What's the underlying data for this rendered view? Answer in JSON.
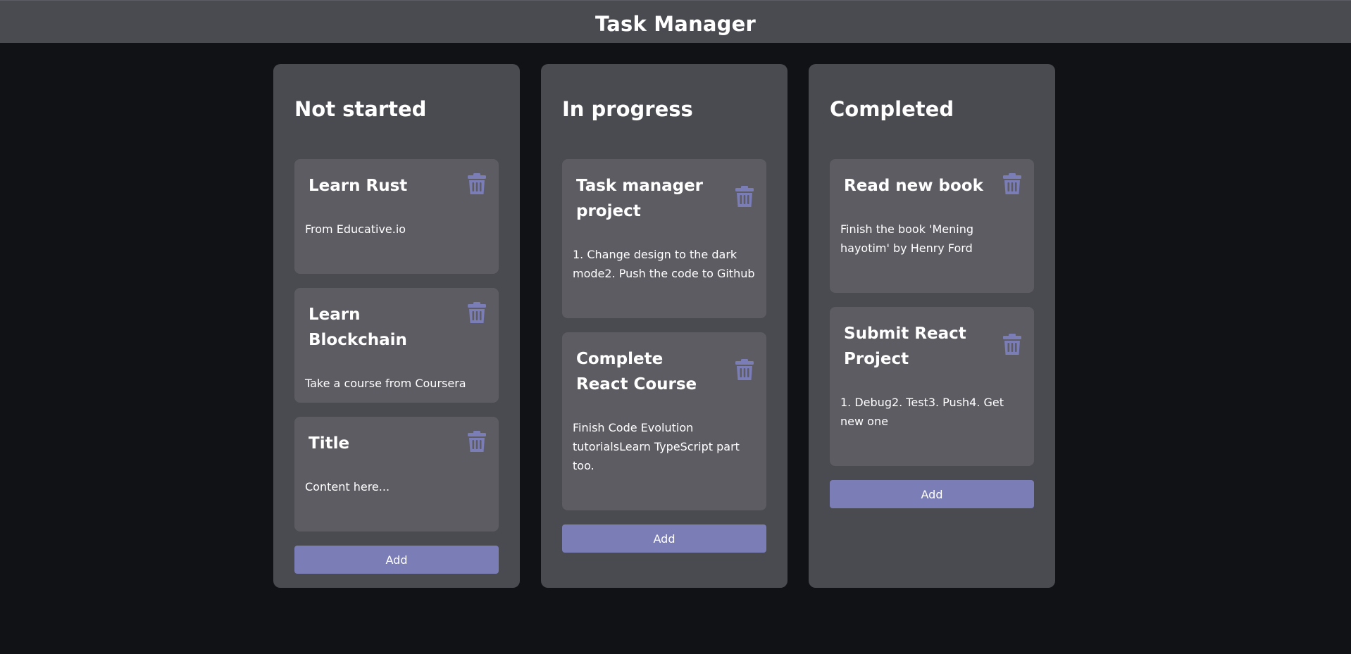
{
  "app": {
    "title": "Task Manager"
  },
  "colors": {
    "accent": "#7a7db6",
    "background": "#111215",
    "panel": "#4a4a51",
    "card": "#5d5c63"
  },
  "icons": {
    "delete": "trash-icon"
  },
  "columns": [
    {
      "title": "Not started",
      "add_label": "Add",
      "cards": [
        {
          "title": "Learn Rust",
          "content": "From Educative.io"
        },
        {
          "title": "Learn Blockchain",
          "content": "Take a course from Coursera"
        },
        {
          "title": "Title",
          "content": "Content here..."
        }
      ]
    },
    {
      "title": "In progress",
      "add_label": "Add",
      "cards": [
        {
          "title": "Task manager project",
          "content": "1. Change design to the dark mode2. Push the code to Github"
        },
        {
          "title": "Complete React Course",
          "content": "Finish Code Evolution tutorialsLearn TypeScript part too."
        }
      ]
    },
    {
      "title": "Completed",
      "add_label": "Add",
      "cards": [
        {
          "title": "Read new book",
          "content": "Finish the book 'Mening hayotim'  by Henry Ford"
        },
        {
          "title": "Submit React Project",
          "content": "1.  Debug2. Test3.  Push4.  Get new one"
        }
      ]
    }
  ]
}
